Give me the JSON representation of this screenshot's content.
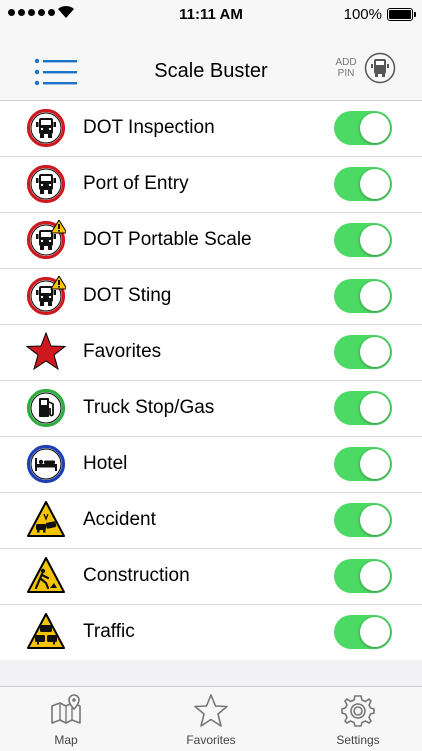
{
  "status_bar": {
    "time": "11:11 AM",
    "battery": "100%"
  },
  "header": {
    "title": "Scale Buster",
    "add_pin_line1": "ADD",
    "add_pin_line2": "PIN"
  },
  "colors": {
    "toggle_on": "#4cd964",
    "menu_accent": "#1a73c9"
  },
  "layers": [
    {
      "label": "DOT Inspection",
      "icon": "truck-circle-icon",
      "enabled": true
    },
    {
      "label": "Port of Entry",
      "icon": "truck-circle-icon",
      "enabled": true
    },
    {
      "label": "DOT Portable Scale",
      "icon": "truck-warning-icon",
      "enabled": true
    },
    {
      "label": "DOT Sting",
      "icon": "truck-warning-icon",
      "enabled": true
    },
    {
      "label": "Favorites",
      "icon": "star-icon",
      "enabled": true
    },
    {
      "label": "Truck Stop/Gas",
      "icon": "gas-pump-icon",
      "enabled": true
    },
    {
      "label": "Hotel",
      "icon": "bed-icon",
      "enabled": true
    },
    {
      "label": "Accident",
      "icon": "accident-sign-icon",
      "enabled": true
    },
    {
      "label": "Construction",
      "icon": "construction-sign-icon",
      "enabled": true
    },
    {
      "label": "Traffic",
      "icon": "traffic-sign-icon",
      "enabled": true
    }
  ],
  "tabs": [
    {
      "label": "Map",
      "icon": "map-icon"
    },
    {
      "label": "Favorites",
      "icon": "star-outline-icon"
    },
    {
      "label": "Settings",
      "icon": "gear-icon"
    }
  ]
}
